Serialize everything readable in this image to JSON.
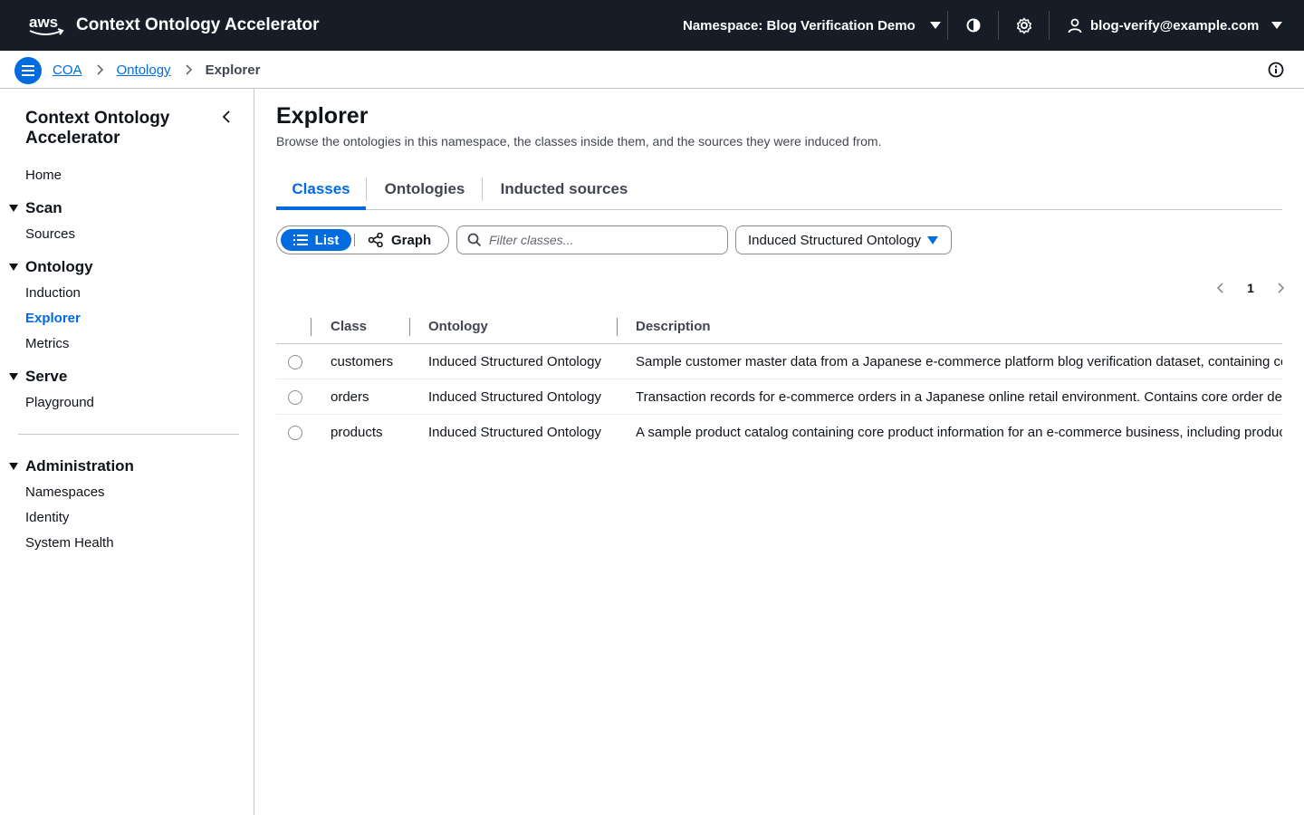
{
  "topnav": {
    "logo_text": "aws",
    "app_title": "Context Ontology Accelerator",
    "namespace_label": "Namespace: Blog Verification Demo",
    "user_email": "blog-verify@example.com"
  },
  "breadcrumb": {
    "items": [
      "COA",
      "Ontology"
    ],
    "current": "Explorer"
  },
  "sidebar": {
    "title": "Context Ontology Accelerator",
    "home": "Home",
    "sections": [
      {
        "label": "Scan",
        "items": [
          "Sources"
        ]
      },
      {
        "label": "Ontology",
        "items": [
          "Induction",
          "Explorer",
          "Metrics"
        ]
      },
      {
        "label": "Serve",
        "items": [
          "Playground"
        ]
      },
      {
        "label": "Administration",
        "items": [
          "Namespaces",
          "Identity",
          "System Health"
        ]
      }
    ],
    "active_item": "Explorer"
  },
  "main": {
    "title": "Explorer",
    "description": "Browse the ontologies in this namespace, the classes inside them, and the sources they were induced from.",
    "tabs": [
      "Classes",
      "Ontologies",
      "Inducted sources"
    ],
    "active_tab": "Classes",
    "view_toggle": {
      "list": "List",
      "graph": "Graph",
      "selected": "List"
    },
    "filter_placeholder": "Filter classes...",
    "ontology_select": "Induced Structured Ontology",
    "page": "1"
  },
  "table": {
    "columns": [
      "Class",
      "Ontology",
      "Description"
    ],
    "rows": [
      {
        "class": "customers",
        "ontology": "Induced Structured Ontology",
        "description": "Sample customer master data from a Japanese e-commerce platform blog verification dataset, containing core"
      },
      {
        "class": "orders",
        "ontology": "Induced Structured Ontology",
        "description": "Transaction records for e-commerce orders in a Japanese online retail environment. Contains core order deta"
      },
      {
        "class": "products",
        "ontology": "Induced Structured Ontology",
        "description": "A sample product catalog containing core product information for an e-commerce business, including product"
      }
    ]
  },
  "colors": {
    "topbar": "#161d26",
    "accent": "#006ce0",
    "text": "#0f141a",
    "muted": "#424650"
  }
}
